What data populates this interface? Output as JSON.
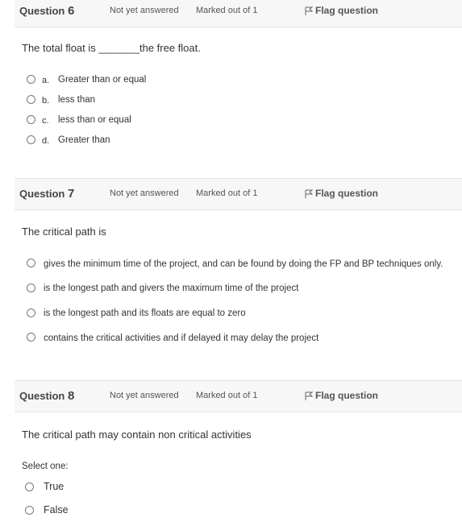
{
  "q6": {
    "label": "Question",
    "num": "6",
    "status": "Not yet answered",
    "marks": "Marked out of 1",
    "flag": "Flag question",
    "text": "The total float is _______the free float.",
    "options": [
      {
        "letter": "a.",
        "text": "Greater than or equal"
      },
      {
        "letter": "b.",
        "text": "less than"
      },
      {
        "letter": "c.",
        "text": "less than or equal"
      },
      {
        "letter": "d.",
        "text": "Greater than"
      }
    ]
  },
  "q7": {
    "label": "Question",
    "num": "7",
    "status": "Not yet answered",
    "marks": "Marked out of 1",
    "flag": "Flag question",
    "text": "The critical path is",
    "options": [
      {
        "text": "gives the minimum time of the project, and can be found by doing the FP and BP techniques only."
      },
      {
        "text": "is the longest path and givers the maximum time of the project"
      },
      {
        "text": "is the longest path and its floats are equal to zero"
      },
      {
        "text": "contains the critical activities and if delayed it may delay the project"
      }
    ]
  },
  "q8": {
    "label": "Question",
    "num": "8",
    "status": "Not yet answered",
    "marks": "Marked out of 1",
    "flag": "Flag question",
    "text": "The critical path may contain non critical activities",
    "prompt": "Select one:",
    "options": [
      {
        "text": "True"
      },
      {
        "text": "False"
      }
    ]
  }
}
